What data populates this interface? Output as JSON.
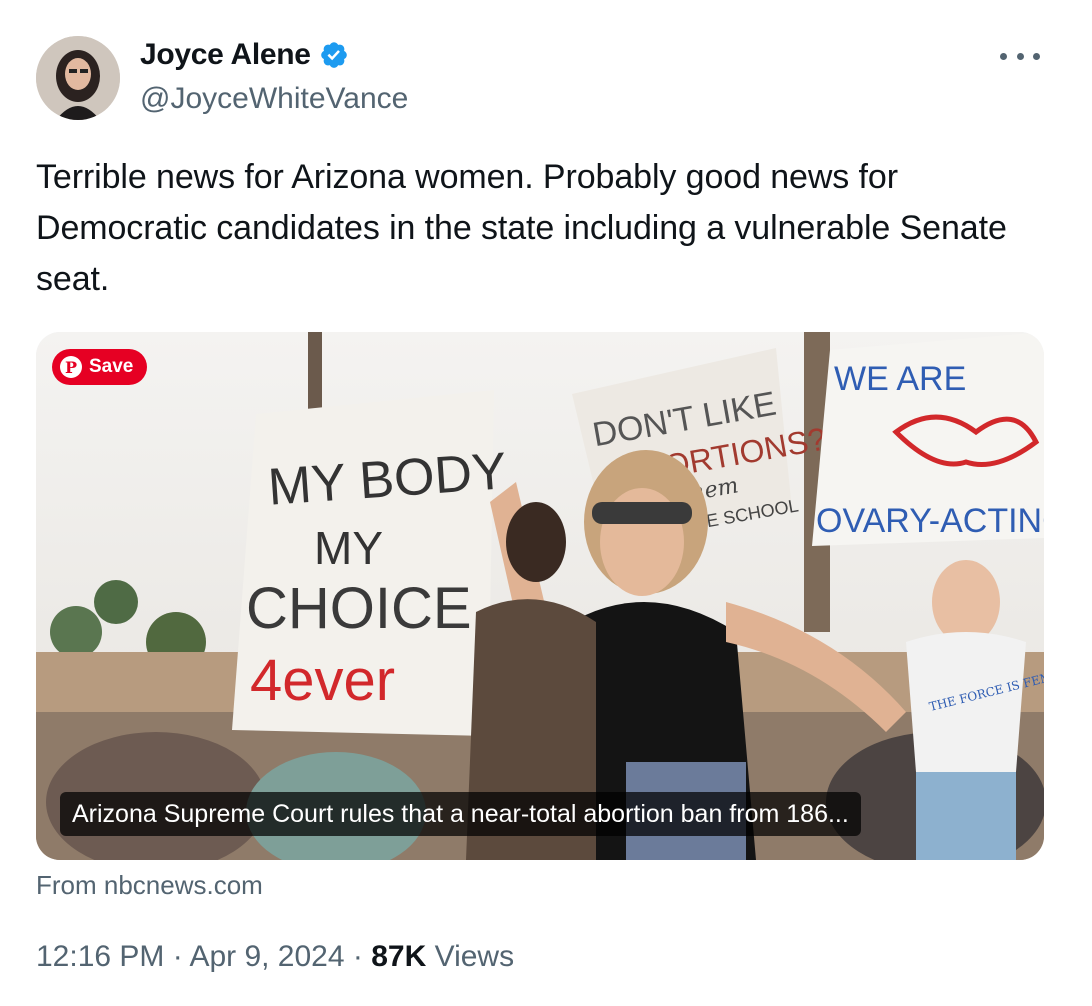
{
  "author": {
    "display_name": "Joyce Alene",
    "handle": "@JoyceWhiteVance",
    "verified": true,
    "verified_color": "#1d9bf0"
  },
  "tweet": {
    "text": "Terrible news for Arizona women. Probably good news for Democratic candidates in the state including a vulnerable Senate seat."
  },
  "card": {
    "save_label": "Save",
    "headline": "Arizona Supreme Court rules that a near-total abortion ban from 186...",
    "source": "From nbcnews.com",
    "signs": {
      "sign1_line1": "MY BODY",
      "sign1_line2": "MY",
      "sign1_line3": "CHOICE",
      "sign1_line4": "4ever",
      "sign2_line1": "DON'T LIKE",
      "sign2_line2": "ABORTIONS?",
      "sign2_line3": "them",
      "sign2_line4": "ORE SCHOOL",
      "sign3_line1": "WE ARE",
      "sign3_line2": "OVARY-ACTING",
      "shirt_text": "THE FORCE IS FEMALE"
    }
  },
  "meta": {
    "time": "12:16 PM",
    "separator": " · ",
    "date": "Apr 9, 2024",
    "views_count": "87K",
    "views_label": " Views"
  },
  "colors": {
    "text_primary": "#0f1419",
    "text_secondary": "#536471",
    "pinterest_red": "#e60023"
  }
}
